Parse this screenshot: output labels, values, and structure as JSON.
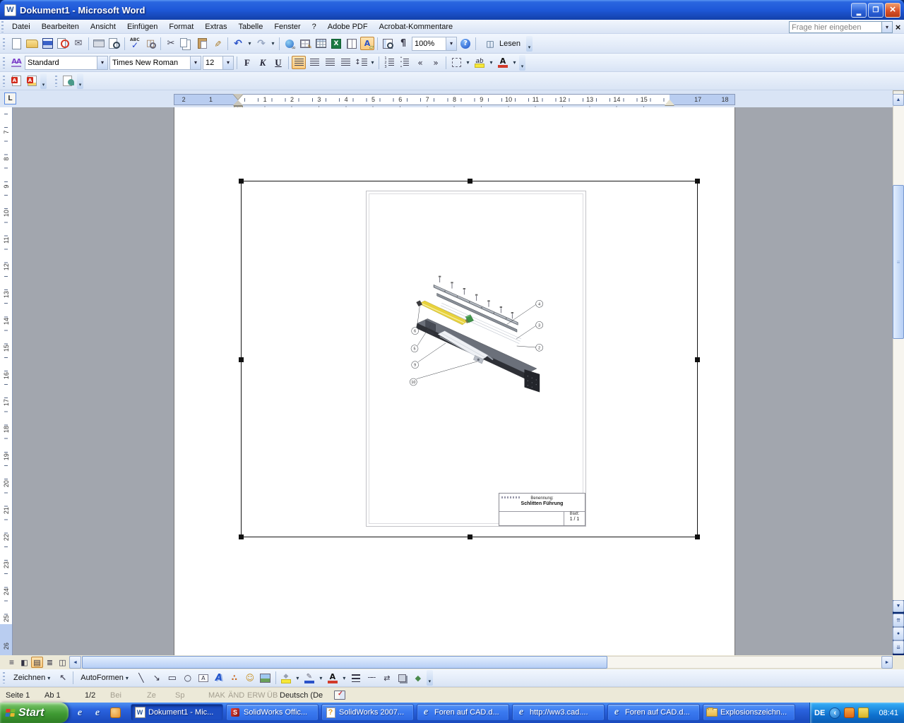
{
  "window": {
    "title": "Dokument1 - Microsoft Word"
  },
  "menu": {
    "items": [
      "Datei",
      "Bearbeiten",
      "Ansicht",
      "Einfügen",
      "Format",
      "Extras",
      "Tabelle",
      "Fenster",
      "?",
      "Adobe PDF",
      "Acrobat-Kommentare"
    ],
    "question_placeholder": "Frage hier eingeben"
  },
  "std": {
    "zoom_value": "100%",
    "read_label": "Lesen",
    "icons": [
      {
        "icon": "new-document-icon"
      },
      {
        "icon": "open-icon"
      },
      {
        "icon": "save-icon"
      },
      {
        "icon": "permission-icon"
      },
      {
        "icon": "email-icon"
      },
      {
        "icon": "separator"
      },
      {
        "icon": "print-icon"
      },
      {
        "icon": "print-preview-icon"
      },
      {
        "icon": "separator"
      },
      {
        "icon": "spelling-icon"
      },
      {
        "icon": "research-icon"
      },
      {
        "icon": "separator"
      },
      {
        "icon": "cut-icon"
      },
      {
        "icon": "copy-icon"
      },
      {
        "icon": "paste-icon"
      },
      {
        "icon": "format-painter-icon"
      },
      {
        "icon": "separator"
      },
      {
        "icon": "undo-icon"
      },
      {
        "icon": "dropdown-arrow-icon"
      },
      {
        "icon": "redo-icon"
      },
      {
        "icon": "dropdown-arrow-icon"
      },
      {
        "icon": "separator"
      },
      {
        "icon": "hyperlink-icon"
      },
      {
        "icon": "tables-borders-icon"
      },
      {
        "icon": "insert-table-icon"
      },
      {
        "icon": "insert-excel-icon"
      },
      {
        "icon": "columns-icon"
      },
      {
        "icon": "drawing-icon",
        "active": true
      },
      {
        "icon": "separator"
      },
      {
        "icon": "document-map-icon"
      },
      {
        "icon": "show-hide-icon"
      }
    ]
  },
  "fmt": {
    "style_value": "Standard",
    "font_value": "Times New Roman",
    "size_value": "12",
    "bold_label": "F",
    "italic_label": "K",
    "underline_label": "U",
    "icons": [
      {
        "icon": "separator"
      },
      {
        "icon": "align-left-icon",
        "active": true
      },
      {
        "icon": "align-center-icon"
      },
      {
        "icon": "align-right-icon"
      },
      {
        "icon": "align-justify-icon"
      },
      {
        "icon": "line-spacing-icon"
      },
      {
        "icon": "dropdown-arrow-icon"
      },
      {
        "icon": "separator"
      },
      {
        "icon": "numbering-icon"
      },
      {
        "icon": "bullets-icon"
      },
      {
        "icon": "decrease-indent-icon"
      },
      {
        "icon": "increase-indent-icon"
      },
      {
        "icon": "separator"
      },
      {
        "icon": "borders-icon"
      },
      {
        "icon": "dropdown-arrow-icon"
      },
      {
        "icon": "highlight-icon"
      },
      {
        "icon": "dropdown-arrow-icon"
      },
      {
        "icon": "font-color-icon"
      },
      {
        "icon": "dropdown-arrow-icon"
      }
    ]
  },
  "pdf": {
    "icons": [
      {
        "icon": "convert-pdf-icon"
      },
      {
        "icon": "convert-pdf-email-icon"
      }
    ]
  },
  "acrobat": {
    "icons": [
      {
        "icon": "acrobat-comment-icon"
      }
    ]
  },
  "ruler_h": {
    "left_numbers": [
      "2",
      "1"
    ],
    "numbers": [
      "1",
      "2",
      "3",
      "4",
      "5",
      "6",
      "7",
      "8",
      "9",
      "10",
      "11",
      "12",
      "13",
      "14",
      "15"
    ],
    "right_numbers": [
      "17",
      "18"
    ]
  },
  "ruler_v": {
    "numbers": [
      "7",
      "8",
      "9",
      "10",
      "11",
      "12",
      "13",
      "14",
      "15",
      "16",
      "17",
      "18",
      "19",
      "20",
      "21",
      "22",
      "23",
      "24",
      "25",
      "26"
    ]
  },
  "drawing": {
    "balloons": [
      "4",
      "3",
      "2",
      "6",
      "5",
      "9",
      "10"
    ],
    "title_block": {
      "label": "Benennung:",
      "value": "Schlitten Führung",
      "sheet_label": "Blatt:",
      "sheet_value": "1 / 1"
    }
  },
  "views": {
    "icons": [
      {
        "icon": "normal-view-icon"
      },
      {
        "icon": "web-layout-icon"
      },
      {
        "icon": "print-layout-icon",
        "active": true
      },
      {
        "icon": "outline-view-icon"
      },
      {
        "icon": "reading-layout-icon"
      }
    ]
  },
  "draw": {
    "draw_label": "Zeichnen",
    "autoshapes_label": "AutoFormen",
    "icons": [
      {
        "icon": "line-icon"
      },
      {
        "icon": "arrow-icon"
      },
      {
        "icon": "rectangle-icon"
      },
      {
        "icon": "oval-icon"
      },
      {
        "icon": "text-box-icon"
      },
      {
        "icon": "wordart-icon"
      },
      {
        "icon": "diagram-icon"
      },
      {
        "icon": "clipart-icon"
      },
      {
        "icon": "picture-icon"
      },
      {
        "icon": "separator"
      },
      {
        "icon": "fill-color-icon"
      },
      {
        "icon": "dropdown-arrow-icon"
      },
      {
        "icon": "line-color-icon"
      },
      {
        "icon": "dropdown-arrow-icon"
      },
      {
        "icon": "font-color-icon"
      },
      {
        "icon": "dropdown-arrow-icon"
      },
      {
        "icon": "line-style-icon"
      },
      {
        "icon": "dash-style-icon"
      },
      {
        "icon": "arrow-style-icon"
      },
      {
        "icon": "shadow-style-icon"
      },
      {
        "icon": "3d-style-icon"
      }
    ]
  },
  "status": {
    "fields": [
      "Seite 1",
      "Ab 1",
      "1/2"
    ],
    "dim_fields": [
      "Bei",
      "Ze",
      "Sp",
      "MAK",
      "ÄND",
      "ERW",
      "ÜB"
    ],
    "language": "Deutsch (De"
  },
  "taskbar": {
    "start_label": "Start",
    "quick_launch": [
      {
        "icon": "internet-explorer-icon"
      },
      {
        "icon": "internet-explorer-icon"
      },
      {
        "icon": "clock-icon"
      }
    ],
    "tasks": [
      {
        "label": "Dokument1 - Mic...",
        "icon": "word-icon",
        "active": true
      },
      {
        "label": "SolidWorks Offic...",
        "icon": "solidworks-icon"
      },
      {
        "label": "SolidWorks 2007...",
        "icon": "help-file-icon"
      },
      {
        "label": "Foren auf CAD.d...",
        "icon": "internet-explorer-icon"
      },
      {
        "label": "http://ww3.cad....",
        "icon": "internet-explorer-icon"
      },
      {
        "label": "Foren auf CAD.d...",
        "icon": "internet-explorer-icon"
      },
      {
        "label": "Explosionszeichn...",
        "icon": "folder-icon"
      }
    ],
    "tray": {
      "language": "DE",
      "icons": [
        {
          "icon": "hide-icons-icon"
        },
        {
          "icon": "security-alert-icon"
        },
        {
          "icon": "network-icon"
        }
      ],
      "time": "08:41"
    }
  },
  "colors": {
    "title_bar_blue": "#1e58d8",
    "toolbar_blue": "#d9e4f5",
    "taskbar_blue": "#2a63de",
    "start_green": "#3f9a33",
    "pressed_orange": "#f9c97c",
    "status_tan": "#ece9d8",
    "page_gray": "#a2a6ae",
    "select_handle_black": "#111111",
    "actuator_yellow": "#e8d23c"
  }
}
